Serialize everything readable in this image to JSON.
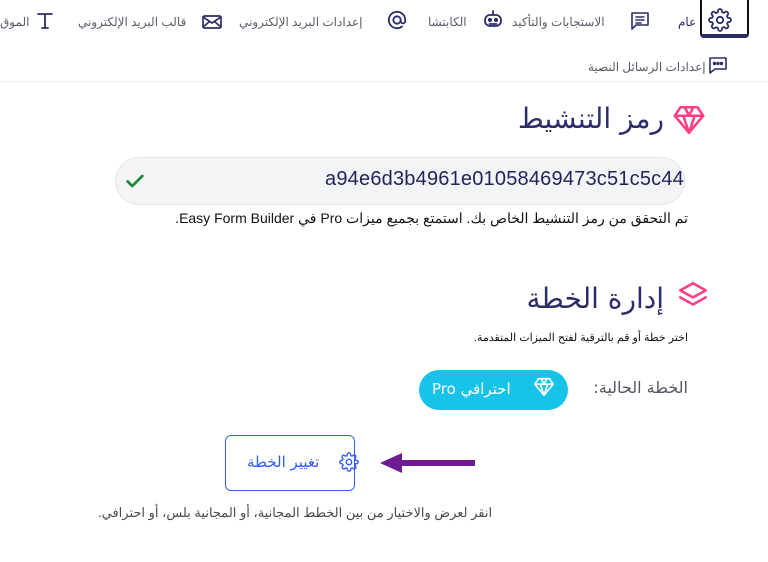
{
  "tabs": {
    "general": "عام",
    "responses": "الاستجابات والتأكيد",
    "captcha": "الكابتشا",
    "email_settings": "إعدادات البريد الإلكتروني",
    "email_template": "قالب البريد الإلكتروني",
    "site": "الموق",
    "sms_settings": "إعدادات الرسائل النصية"
  },
  "activation": {
    "title": "رمز التنشيط",
    "code": "a94e6d3b4961e01058469473c51c5c44",
    "note": "تم التحقق من رمز التنشيط الخاص بك. استمتع بجميع ميزات Pro في Easy Form Builder."
  },
  "plan": {
    "title": "إدارة الخطة",
    "hint": "اختر خطة أو قم بالترقية لفتح الميزات المتقدمة.",
    "current_label": "الخطة الحالية:",
    "current_plan": "احترافي Pro",
    "change_button": "تغيير الخطة",
    "footer_note": "انقر لعرض والاختيار من بين الخطط المجانية، أو المجانية بلس، أو احترافي."
  },
  "icons": {
    "general": "gear-icon",
    "responses": "message-square-icon",
    "captcha": "robot-icon",
    "email_settings": "at-icon",
    "email_template": "mail-icon",
    "site": "text-icon",
    "sms_settings": "chat-dots-icon",
    "activation": "diamond-icon",
    "plan": "layers-icon",
    "verified": "check-icon",
    "plan_badge": "diamond-icon",
    "change_plan": "gear-icon",
    "pointer": "arrow-left-icon"
  },
  "colors": {
    "primary_text": "#2d2d6a",
    "accent_pink": "#ff3e88",
    "pill_cyan": "#18c3ea",
    "button_blue": "#3b63ff",
    "arrow_purple": "#6d1d8f",
    "check_green": "#1f8a3a"
  }
}
